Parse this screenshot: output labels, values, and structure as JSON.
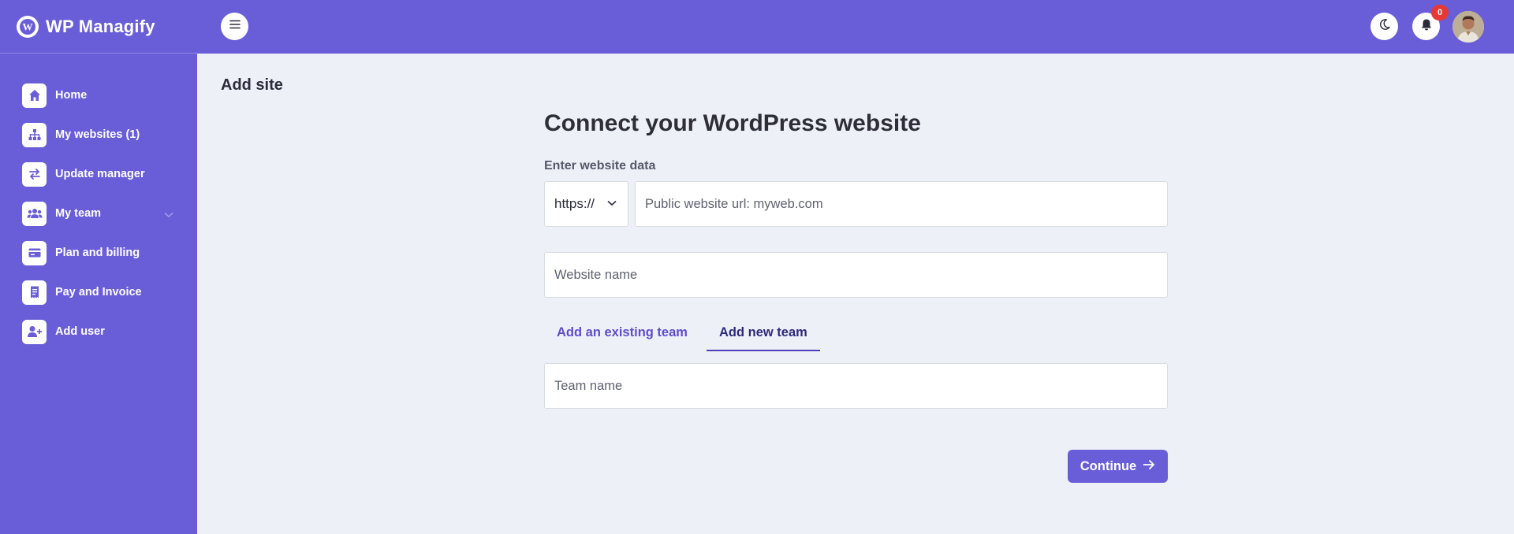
{
  "brand": {
    "name": "WP Managify"
  },
  "sidebar": {
    "items": [
      {
        "label": "Home",
        "icon": "home-icon"
      },
      {
        "label": "My websites (1)",
        "icon": "sitemap-icon"
      },
      {
        "label": "Update manager",
        "icon": "swap-arrows-icon"
      },
      {
        "label": "My team",
        "icon": "users-icon",
        "has_children": true
      },
      {
        "label": "Plan and billing",
        "icon": "credit-card-icon"
      },
      {
        "label": "Pay and Invoice",
        "icon": "receipt-icon"
      },
      {
        "label": "Add user",
        "icon": "user-plus-icon"
      }
    ]
  },
  "topbar": {
    "notifications_count": "0"
  },
  "page": {
    "title": "Add site"
  },
  "form": {
    "heading": "Connect your WordPress website",
    "website_data_label": "Enter website data",
    "protocol_selected": "https://",
    "url_placeholder": "Public website url: myweb.com",
    "website_name_placeholder": "Website name",
    "tabs": [
      {
        "label": "Add an existing team",
        "active": false
      },
      {
        "label": "Add new team",
        "active": true
      }
    ],
    "team_name_placeholder": "Team name",
    "continue_label": "Continue"
  },
  "colors": {
    "primary": "#695ed8",
    "background": "#eef0f8",
    "badge": "#e53935"
  }
}
